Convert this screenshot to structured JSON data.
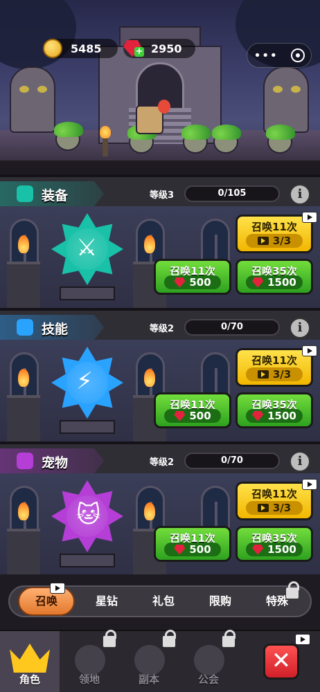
{
  "resources": {
    "gold": "5485",
    "gems": "2950",
    "gem_plus": "+"
  },
  "capsule": {
    "more_icon": "•••"
  },
  "panels": [
    {
      "id": "equipment",
      "title": "装备",
      "level": "等级3",
      "progress": "0/105",
      "info": "i",
      "icon": "equipment-icon",
      "color": "#19c1a8",
      "item_symbol": "⚔",
      "summon_ad": {
        "label": "召唤11次",
        "count": "3/3"
      },
      "summon_11": {
        "label": "召唤11次",
        "cost": "500"
      },
      "summon_35": {
        "label": "召唤35次",
        "cost": "1500"
      }
    },
    {
      "id": "skill",
      "title": "技能",
      "level": "等级2",
      "progress": "0/70",
      "info": "i",
      "icon": "lightning-icon",
      "color": "#2aa3ff",
      "item_symbol": "⚡",
      "summon_ad": {
        "label": "召唤11次",
        "count": "3/3"
      },
      "summon_11": {
        "label": "召唤11次",
        "cost": "500"
      },
      "summon_35": {
        "label": "召唤35次",
        "cost": "1500"
      }
    },
    {
      "id": "pet",
      "title": "宠物",
      "level": "等级2",
      "progress": "0/70",
      "info": "i",
      "icon": "cat-icon",
      "color": "#b43ed6",
      "item_symbol": "🐱",
      "summon_ad": {
        "label": "召唤11次",
        "count": "3/3"
      },
      "summon_11": {
        "label": "召唤11次",
        "cost": "500"
      },
      "summon_35": {
        "label": "召唤35次",
        "cost": "1500"
      }
    }
  ],
  "subtabs": [
    "召唤",
    "星钻",
    "礼包",
    "限购",
    "特殊"
  ],
  "nav": {
    "character": "角色",
    "territory": "领地",
    "dungeon": "副本",
    "guild": "公会",
    "close": "✕"
  }
}
